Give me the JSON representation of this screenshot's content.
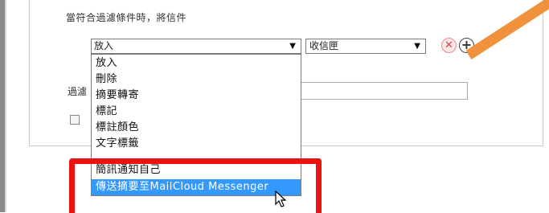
{
  "rule": {
    "condition_label": "當符合過濾條件時，將信件",
    "action_select": {
      "value": "放入",
      "caret": "▼"
    },
    "folder_select": {
      "value": "收信匣",
      "caret": "▼"
    },
    "remove_glyph": "✕",
    "add_glyph": "+"
  },
  "filter": {
    "label": "過濾"
  },
  "dropdown": {
    "options": [
      "放入",
      "刪除",
      "摘要轉寄",
      "標記",
      "標註顏色",
      "文字標籤",
      "簡訊通知自己",
      "傳送摘要至MailCloud Messenger"
    ],
    "selected_index": 7
  },
  "colors": {
    "highlight": "#ee1111",
    "selection": "#3399ff",
    "arrow": "#f0913c"
  },
  "icons": {
    "remove": "close-circle-icon",
    "add": "plus-circle-icon",
    "cursor": "mouse-pointer-icon"
  }
}
